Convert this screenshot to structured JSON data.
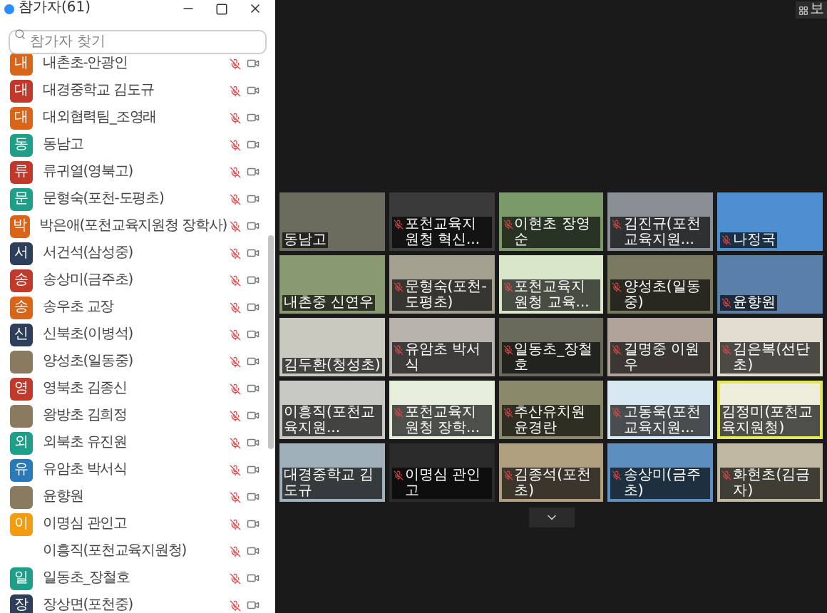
{
  "panel": {
    "title": "참가자(61)",
    "search": {
      "placeholder": "참가자 찾기"
    },
    "participants": [
      {
        "kind": "initial",
        "initial": "내",
        "color": "#d9651b",
        "name": "내촌초-안광인"
      },
      {
        "kind": "initial",
        "initial": "대",
        "color": "#c0392b",
        "name": "대경중학교 김도규"
      },
      {
        "kind": "initial",
        "initial": "대",
        "color": "#d9651b",
        "name": "대외협력팀_조영래"
      },
      {
        "kind": "initial",
        "initial": "동",
        "color": "#1f9e8a",
        "name": "동남고"
      },
      {
        "kind": "initial",
        "initial": "류",
        "color": "#c0392b",
        "name": "류귀열(영북고)"
      },
      {
        "kind": "initial",
        "initial": "문",
        "color": "#1f9e8a",
        "name": "문형숙(포천-도평초)"
      },
      {
        "kind": "initial",
        "initial": "박",
        "color": "#d9651b",
        "name": "박은애(포천교육지원청 장학사)"
      },
      {
        "kind": "initial",
        "initial": "서",
        "color": "#2c3e5a",
        "name": "서건석(삼성중)"
      },
      {
        "kind": "initial",
        "initial": "송",
        "color": "#c0392b",
        "name": "송상미(금주초)"
      },
      {
        "kind": "initial",
        "initial": "송",
        "color": "#d9651b",
        "name": "송우초 교장"
      },
      {
        "kind": "initial",
        "initial": "신",
        "color": "#2c3e5a",
        "name": "신북초(이병석)"
      },
      {
        "kind": "photo",
        "name": "양성초(일동중)"
      },
      {
        "kind": "initial",
        "initial": "영",
        "color": "#c0392b",
        "name": "영북초 김종신"
      },
      {
        "kind": "photo",
        "name": "왕방초 김희정"
      },
      {
        "kind": "initial",
        "initial": "외",
        "color": "#1f9e8a",
        "name": "외북초 유진원"
      },
      {
        "kind": "initial",
        "initial": "유",
        "color": "#2a7ab8",
        "name": "유암초 박서식"
      },
      {
        "kind": "photo",
        "name": "윤향원"
      },
      {
        "kind": "initial",
        "initial": "이",
        "color": "#f39c12",
        "name": "이명심 관인고"
      },
      {
        "kind": "none",
        "name": "이흥직(포천교육지원청)"
      },
      {
        "kind": "initial",
        "initial": "일",
        "color": "#1f9e8a",
        "name": "일동초_장철호"
      },
      {
        "kind": "initial",
        "initial": "장",
        "color": "#2c3e5a",
        "name": "장상면(포천중)"
      }
    ]
  },
  "view_button": "보",
  "tiles": [
    {
      "name": "동남고",
      "muted": false,
      "speaking": false
    },
    {
      "name": "포천교육지원청 혁신...",
      "muted": true,
      "speaking": false
    },
    {
      "name": "이현초 장영순",
      "muted": true,
      "speaking": false
    },
    {
      "name": "김진규(포천교육지원...",
      "muted": true,
      "speaking": false
    },
    {
      "name": "나정국",
      "muted": true,
      "speaking": false
    },
    {
      "name": "내촌중 신연우",
      "muted": false,
      "speaking": false
    },
    {
      "name": "문형숙(포천-도평초)",
      "muted": true,
      "speaking": false
    },
    {
      "name": "포천교육지원청 교육...",
      "muted": true,
      "speaking": false
    },
    {
      "name": "양성초(일동중)",
      "muted": true,
      "speaking": false
    },
    {
      "name": "윤향원",
      "muted": true,
      "speaking": false
    },
    {
      "name": "김두환(청성초)",
      "muted": false,
      "speaking": false
    },
    {
      "name": "유암초 박서식",
      "muted": true,
      "speaking": false
    },
    {
      "name": "일동초_장철호",
      "muted": true,
      "speaking": false
    },
    {
      "name": "길명중 이원우",
      "muted": true,
      "speaking": false
    },
    {
      "name": "김은복(선단초)",
      "muted": true,
      "speaking": false
    },
    {
      "name": "이흥직(포천교육지원...",
      "muted": false,
      "speaking": false
    },
    {
      "name": "포천교육지원청 장학...",
      "muted": true,
      "speaking": false
    },
    {
      "name": "추산유치원 윤경란",
      "muted": true,
      "speaking": false
    },
    {
      "name": "고동욱(포천교육지원...",
      "muted": true,
      "speaking": false
    },
    {
      "name": "김정미(포천교육지원청)",
      "muted": false,
      "speaking": true
    },
    {
      "name": "대경중학교 김도규",
      "muted": false,
      "speaking": false
    },
    {
      "name": "이명심 관인고",
      "muted": true,
      "speaking": false
    },
    {
      "name": "김종석(포천초)",
      "muted": true,
      "speaking": false
    },
    {
      "name": "송상미(금주초)",
      "muted": true,
      "speaking": false
    },
    {
      "name": "화현초(김금자)",
      "muted": true,
      "speaking": false
    }
  ]
}
